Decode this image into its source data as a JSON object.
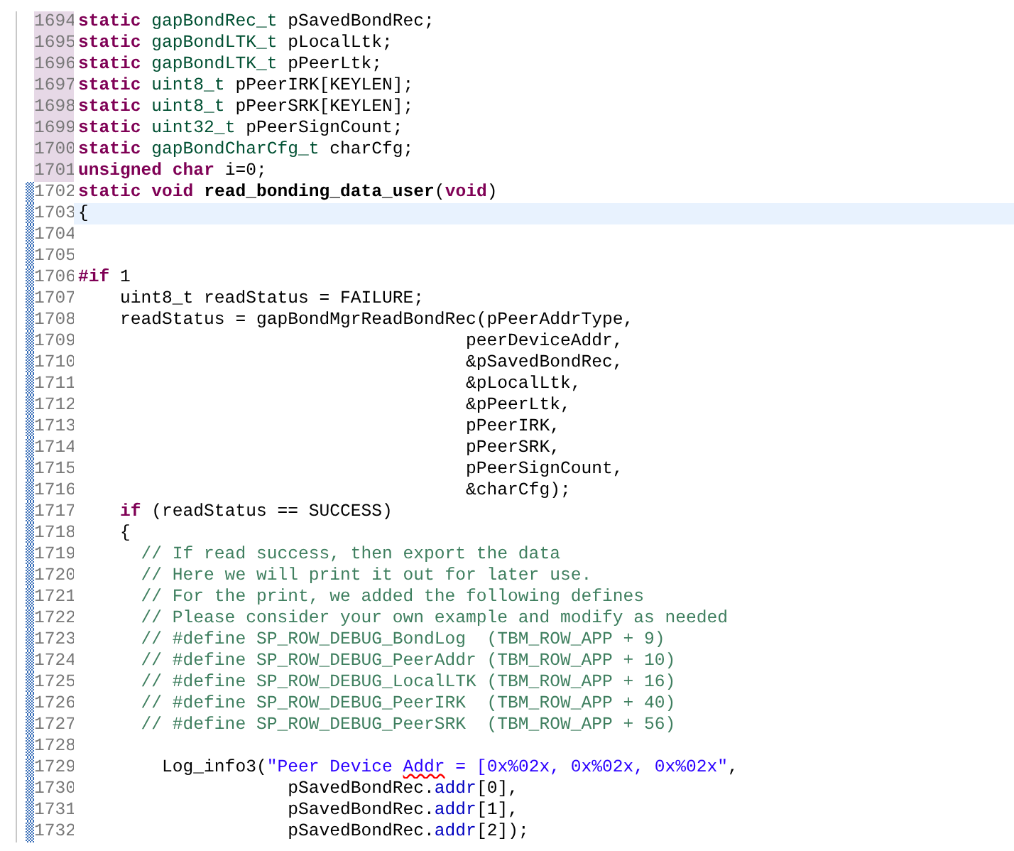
{
  "editor": {
    "lines": [
      {
        "number": "1694",
        "changed": true,
        "added": false,
        "current": false,
        "tokens": [
          {
            "kind": "keyword",
            "text": "static"
          },
          {
            "kind": "type",
            "text": " gapBondRec_t"
          },
          {
            "kind": "plain",
            "text": " pSavedBondRec;"
          }
        ]
      },
      {
        "number": "1695",
        "changed": true,
        "added": false,
        "current": false,
        "tokens": [
          {
            "kind": "keyword",
            "text": "static"
          },
          {
            "kind": "type",
            "text": " gapBondLTK_t"
          },
          {
            "kind": "plain",
            "text": " pLocalLtk;"
          }
        ]
      },
      {
        "number": "1696",
        "changed": true,
        "added": false,
        "current": false,
        "tokens": [
          {
            "kind": "keyword",
            "text": "static"
          },
          {
            "kind": "type",
            "text": " gapBondLTK_t"
          },
          {
            "kind": "plain",
            "text": " pPeerLtk;"
          }
        ]
      },
      {
        "number": "1697",
        "changed": true,
        "added": false,
        "current": false,
        "tokens": [
          {
            "kind": "keyword",
            "text": "static"
          },
          {
            "kind": "type",
            "text": " uint8_t"
          },
          {
            "kind": "plain",
            "text": " pPeerIRK[KEYLEN];"
          }
        ]
      },
      {
        "number": "1698",
        "changed": true,
        "added": false,
        "current": false,
        "tokens": [
          {
            "kind": "keyword",
            "text": "static"
          },
          {
            "kind": "type",
            "text": " uint8_t"
          },
          {
            "kind": "plain",
            "text": " pPeerSRK[KEYLEN];"
          }
        ]
      },
      {
        "number": "1699",
        "changed": true,
        "added": false,
        "current": false,
        "tokens": [
          {
            "kind": "keyword",
            "text": "static"
          },
          {
            "kind": "type",
            "text": " uint32_t"
          },
          {
            "kind": "plain",
            "text": " pPeerSignCount;"
          }
        ]
      },
      {
        "number": "1700",
        "changed": true,
        "added": false,
        "current": false,
        "tokens": [
          {
            "kind": "keyword",
            "text": "static"
          },
          {
            "kind": "type",
            "text": " gapBondCharCfg_t"
          },
          {
            "kind": "plain",
            "text": " charCfg;"
          }
        ]
      },
      {
        "number": "1701",
        "changed": true,
        "added": false,
        "current": false,
        "tokens": [
          {
            "kind": "keyword",
            "text": "unsigned"
          },
          {
            "kind": "keyword",
            "text": " char"
          },
          {
            "kind": "plain",
            "text": " i=0;"
          }
        ]
      },
      {
        "number": "1702",
        "changed": false,
        "added": true,
        "current": false,
        "tokens": [
          {
            "kind": "keyword",
            "text": "static"
          },
          {
            "kind": "keyword",
            "text": " void"
          },
          {
            "kind": "function",
            "text": " read_bonding_data_user"
          },
          {
            "kind": "plain",
            "text": "("
          },
          {
            "kind": "keyword",
            "text": "void"
          },
          {
            "kind": "plain",
            "text": ")"
          }
        ]
      },
      {
        "number": "1703",
        "changed": false,
        "added": true,
        "current": true,
        "tokens": [
          {
            "kind": "plain",
            "text": "{"
          }
        ]
      },
      {
        "number": "1704",
        "changed": false,
        "added": true,
        "current": false
      },
      {
        "number": "1705",
        "changed": false,
        "added": true,
        "current": false
      },
      {
        "number": "1706",
        "changed": false,
        "added": true,
        "current": false,
        "tokens": [
          {
            "kind": "keyword",
            "text": "#if"
          },
          {
            "kind": "plain",
            "text": " 1"
          }
        ]
      },
      {
        "number": "1707",
        "changed": false,
        "added": true,
        "current": false,
        "tokens": [
          {
            "kind": "plain",
            "text": "    uint8_t readStatus = FAILURE;"
          }
        ]
      },
      {
        "number": "1708",
        "changed": false,
        "added": true,
        "current": false,
        "tokens": [
          {
            "kind": "plain",
            "text": "    readStatus = gapBondMgrReadBondRec(pPeerAddrType,"
          }
        ]
      },
      {
        "number": "1709",
        "changed": false,
        "added": true,
        "current": false,
        "tokens": [
          {
            "kind": "plain",
            "text": "                                     peerDeviceAddr,"
          }
        ]
      },
      {
        "number": "1710",
        "changed": false,
        "added": true,
        "current": false,
        "tokens": [
          {
            "kind": "plain",
            "text": "                                     &pSavedBondRec,"
          }
        ]
      },
      {
        "number": "1711",
        "changed": false,
        "added": true,
        "current": false,
        "tokens": [
          {
            "kind": "plain",
            "text": "                                     &pLocalLtk,"
          }
        ]
      },
      {
        "number": "1712",
        "changed": false,
        "added": true,
        "current": false,
        "tokens": [
          {
            "kind": "plain",
            "text": "                                     &pPeerLtk,"
          }
        ]
      },
      {
        "number": "1713",
        "changed": false,
        "added": true,
        "current": false,
        "tokens": [
          {
            "kind": "plain",
            "text": "                                     pPeerIRK,"
          }
        ]
      },
      {
        "number": "1714",
        "changed": false,
        "added": true,
        "current": false,
        "tokens": [
          {
            "kind": "plain",
            "text": "                                     pPeerSRK,"
          }
        ]
      },
      {
        "number": "1715",
        "changed": false,
        "added": true,
        "current": false,
        "tokens": [
          {
            "kind": "plain",
            "text": "                                     pPeerSignCount,"
          }
        ]
      },
      {
        "number": "1716",
        "changed": false,
        "added": true,
        "current": false,
        "tokens": [
          {
            "kind": "plain",
            "text": "                                     &charCfg);"
          }
        ]
      },
      {
        "number": "1717",
        "changed": false,
        "added": true,
        "current": false,
        "tokens": [
          {
            "kind": "keyword",
            "text": "    if"
          },
          {
            "kind": "plain",
            "text": " (readStatus == SUCCESS)"
          }
        ]
      },
      {
        "number": "1718",
        "changed": false,
        "added": true,
        "current": false,
        "tokens": [
          {
            "kind": "plain",
            "text": "    {"
          }
        ]
      },
      {
        "number": "1719",
        "changed": false,
        "added": true,
        "current": false,
        "tokens": [
          {
            "kind": "comment",
            "text": "      // If read success, then export the data"
          }
        ]
      },
      {
        "number": "1720",
        "changed": false,
        "added": true,
        "current": false,
        "tokens": [
          {
            "kind": "comment",
            "text": "      // Here we will print it out for later use."
          }
        ]
      },
      {
        "number": "1721",
        "changed": false,
        "added": true,
        "current": false,
        "tokens": [
          {
            "kind": "comment",
            "text": "      // For the print, we added the following defines"
          }
        ]
      },
      {
        "number": "1722",
        "changed": false,
        "added": true,
        "current": false,
        "tokens": [
          {
            "kind": "comment",
            "text": "      // Please consider your own example and modify as needed"
          }
        ]
      },
      {
        "number": "1723",
        "changed": false,
        "added": true,
        "current": false,
        "tokens": [
          {
            "kind": "comment",
            "text": "      // #define SP_ROW_DEBUG_BondLog  (TBM_ROW_APP + 9)"
          }
        ]
      },
      {
        "number": "1724",
        "changed": false,
        "added": true,
        "current": false,
        "tokens": [
          {
            "kind": "comment",
            "text": "      // #define SP_ROW_DEBUG_PeerAddr (TBM_ROW_APP + 10)"
          }
        ]
      },
      {
        "number": "1725",
        "changed": false,
        "added": true,
        "current": false,
        "tokens": [
          {
            "kind": "comment",
            "text": "      // #define SP_ROW_DEBUG_LocalLTK (TBM_ROW_APP + 16)"
          }
        ]
      },
      {
        "number": "1726",
        "changed": false,
        "added": true,
        "current": false,
        "tokens": [
          {
            "kind": "comment",
            "text": "      // #define SP_ROW_DEBUG_PeerIRK  (TBM_ROW_APP + 40)"
          }
        ]
      },
      {
        "number": "1727",
        "changed": false,
        "added": true,
        "current": false,
        "tokens": [
          {
            "kind": "comment",
            "text": "      // #define SP_ROW_DEBUG_PeerSRK  (TBM_ROW_APP + 56)"
          }
        ]
      },
      {
        "number": "1728",
        "changed": false,
        "added": true,
        "current": false
      },
      {
        "number": "1729",
        "changed": false,
        "added": true,
        "current": false,
        "tokens": [
          {
            "kind": "plain",
            "text": "        Log_info3("
          },
          {
            "kind": "string",
            "text": "\"Peer Device "
          },
          {
            "kind": "string",
            "text": "Addr",
            "misspelled": true
          },
          {
            "kind": "string",
            "text": " = [0x%02x, 0x%02x, 0x%02x\""
          },
          {
            "kind": "plain",
            "text": ","
          }
        ]
      },
      {
        "number": "1730",
        "changed": false,
        "added": true,
        "current": false,
        "tokens": [
          {
            "kind": "plain",
            "text": "                    pSavedBondRec."
          },
          {
            "kind": "field",
            "text": "addr"
          },
          {
            "kind": "plain",
            "text": "[0],"
          }
        ]
      },
      {
        "number": "1731",
        "changed": false,
        "added": true,
        "current": false,
        "tokens": [
          {
            "kind": "plain",
            "text": "                    pSavedBondRec."
          },
          {
            "kind": "field",
            "text": "addr"
          },
          {
            "kind": "plain",
            "text": "[1],"
          }
        ]
      },
      {
        "number": "1732",
        "changed": false,
        "added": true,
        "current": false,
        "tokens": [
          {
            "kind": "plain",
            "text": "                    pSavedBondRec."
          },
          {
            "kind": "field",
            "text": "addr"
          },
          {
            "kind": "plain",
            "text": "[2]);"
          }
        ]
      }
    ]
  }
}
